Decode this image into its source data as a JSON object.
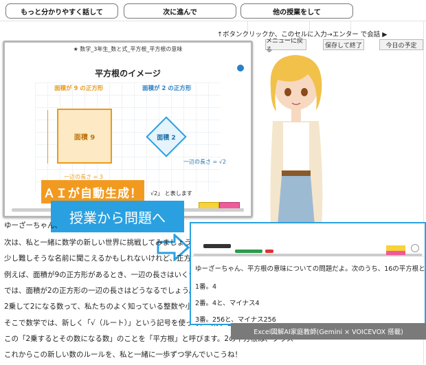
{
  "toolbar": {
    "btn1": "もっと分かりやすく話して",
    "btn2": "次に進んで",
    "btn3": "他の授業をして"
  },
  "hint": "↑ボタンクリックか、このセルに入力→エンター で会話 ▶",
  "menu": {
    "menu_back": "メニューに戻る",
    "save_exit": "保存して終了",
    "today": "今日の予定"
  },
  "board": {
    "header": "★ 数学_3年生_数と式_平方根_平方根の意味",
    "slide_title": "平方根のイメージ",
    "label_area9": "面積が 9 の正方形",
    "label_area2": "面積が 2 の正方形",
    "sq9_text": "面積 9",
    "sq2_text": "面積 2",
    "side_len": "一辺の長さ = √2",
    "side3": "一辺の長さ = 3",
    "footer_frag": "√2」 と表します"
  },
  "banner": {
    "top": "ＡＩが自動生成！",
    "bottom": "授業から問題へ"
  },
  "lesson": [
    "ゆーざーちゃん、",
    "次は、私と一緒に数学の新しい世界に挑戦してみましょう。今日のテー",
    "少し難しそうな名前に聞こえるかもしれないけれど、正方形の面積と",
    "例えば、面積が9の正方形があるとき、一辺の長さはいくつか分かるか",
    "では、面積が2の正方形の一辺の長さはどうなるでしょう。",
    "2乗して2になる数って、私たちのよく知っている整数や小数、分数の",
    "そこで数学では、新しく「√（ルート）」という記号を使って、2乗すると",
    "この「2乗するとその数になる数」のことを「平方根」と呼びます。2の平方根は、プラス",
    "これからこの新しい数のルールを、私と一緒に一歩ずつ学んでいこうね！"
  ],
  "quiz": {
    "question": "ゆーざーちゃん、平方根の意味についての問題だよ。次のうち、16の平方根として正しい",
    "options": [
      "1番。4",
      "2番。4と、マイナス4",
      "3番。256と、マイナス256"
    ]
  },
  "caption": "Excel図解AI家庭教師(Gemini × VOICEVOX 搭載)",
  "colors": {
    "accent": "#2aa0e0",
    "orange": "#e89a1c",
    "banner_orange": "#f29a1f"
  }
}
